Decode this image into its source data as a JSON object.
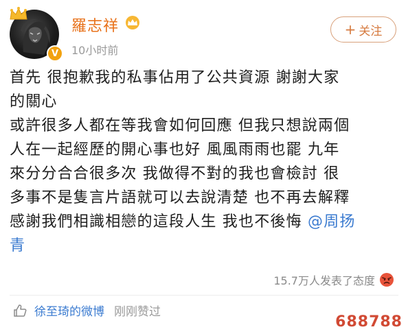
{
  "header": {
    "user_name": "羅志祥",
    "post_time": "10小时前",
    "follow_label": "关注",
    "follow_plus": "+"
  },
  "post": {
    "lines": [
      "首先 很抱歉我的私事佔用了公共資源 謝謝大家",
      "的關心",
      "或許很多人都在等我會如何回應 但我只想說兩個",
      "人在一起經歷的開心事也好 風風雨雨也罷 九年",
      "來分分合合很多次 我做得不對的我也會檢討 很",
      "多事不是隻言片語就可以去說清楚 也不再去解釋",
      "感謝我們相識相戀的這段人生 我也不後悔 "
    ],
    "mention_part1": "@周扬",
    "mention_part2": "青"
  },
  "reactions": {
    "summary": "15.7万人发表了态度"
  },
  "likes": {
    "liker": "徐至琦的微博",
    "action": "刚刚赞过"
  },
  "watermark": "688788",
  "colors": {
    "name_orange": "#e8721b",
    "link_blue": "#3b7bd0",
    "follow_border": "#d8a07a",
    "badge_gold": "#f2a20f"
  },
  "icons": {
    "crown": "crown-icon",
    "vip": "vip-crown-icon",
    "verified": "verified-v-icon",
    "angry": "angry-face-icon",
    "like": "thumbs-up-icon"
  }
}
